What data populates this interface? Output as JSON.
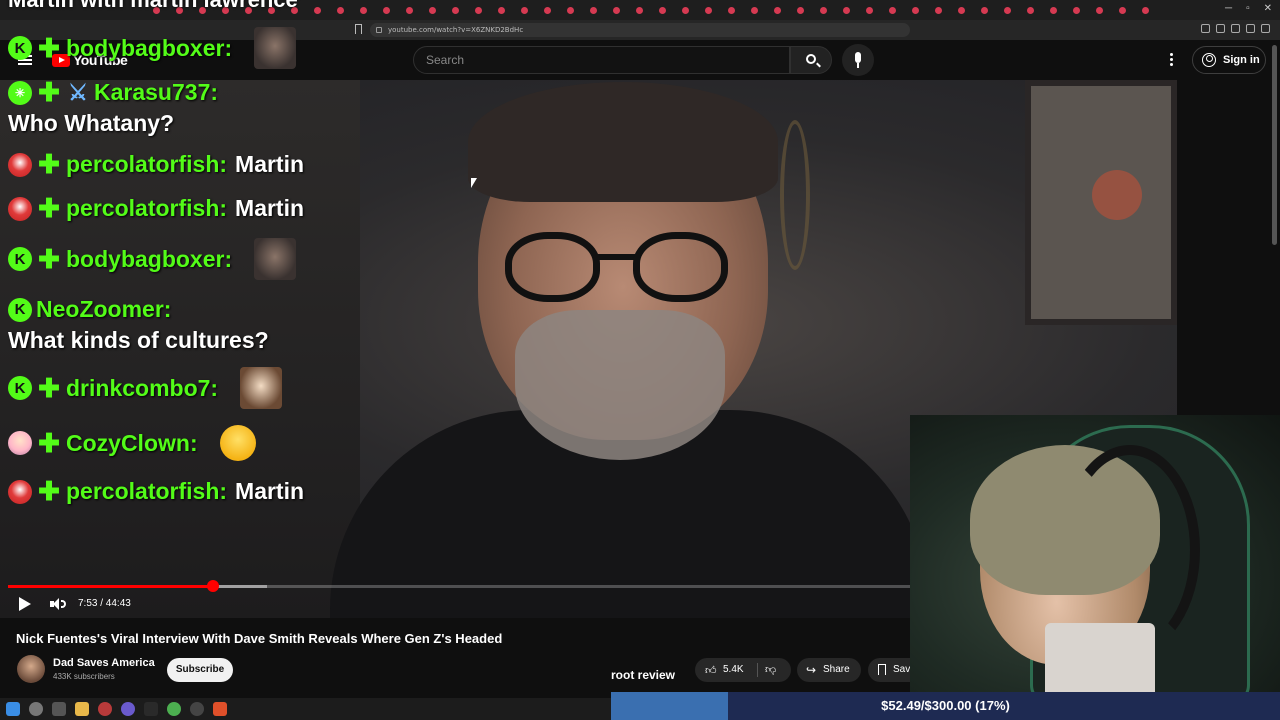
{
  "stream_overlay": {
    "title": "Martin with martin lawrence"
  },
  "browser": {
    "url": "youtube.com/watch?v=X6ZNKD2BdHc"
  },
  "youtube_header": {
    "logo_text": "YouTube",
    "search_placeholder": "Search",
    "sign_in_label": "Sign in"
  },
  "chat": {
    "messages": [
      {
        "username": "bodybagboxer:",
        "text": "",
        "emote": "face-emote"
      },
      {
        "username": "Karasu737:",
        "text": "Who Whatany?"
      },
      {
        "username": "percolatorfish:",
        "text": "Martin"
      },
      {
        "username": "percolatorfish:",
        "text": "Martin"
      },
      {
        "username": "bodybagboxer:",
        "text": "",
        "emote": "face-emote"
      },
      {
        "username": "NeoZoomer:",
        "text": "What kinds of cultures?"
      },
      {
        "username": "drinkcombo7:",
        "text": "",
        "emote": "anime-emote"
      },
      {
        "username": "CozyClown:",
        "text": "",
        "emote": "laughing-emoji"
      },
      {
        "username": "percolatorfish:",
        "text": "Martin"
      }
    ],
    "username_color": "#53fc18"
  },
  "player": {
    "time_display": "7:53 / 44:43",
    "played_fraction": 0.1765,
    "buffered_fraction": 0.2229,
    "accent_color": "#ff0000"
  },
  "video_info": {
    "title": "Nick Fuentes's Viral Interview With Dave Smith Reveals Where Gen Z's Headed",
    "channel_name": "Dad Saves America",
    "subscribers": "433K subscribers",
    "subscribe_label": "Subscribe",
    "like_count": "5.4K",
    "share_label": "Share",
    "save_label": "Save"
  },
  "stream_labels": {
    "root_review": "root review",
    "donation_goal": "$52.49/$300.00 (17%)",
    "donation_fraction": 0.175
  }
}
